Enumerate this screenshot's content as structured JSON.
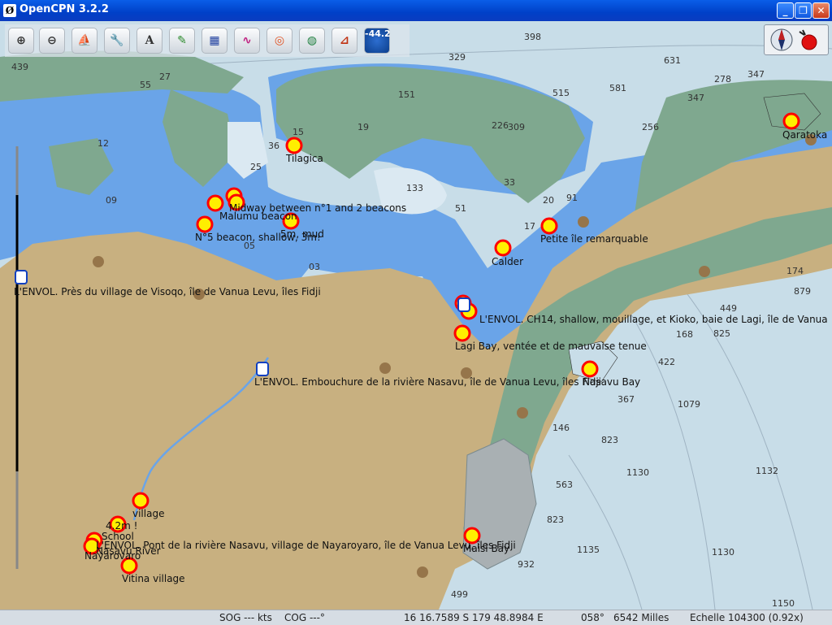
{
  "window": {
    "title": "OpenCPN 3.2.2",
    "buttons": {
      "minimize": "_",
      "restore": "❐",
      "close": "✕"
    }
  },
  "toolbar": {
    "tools": [
      {
        "name": "zoom-in-button",
        "glyph": "⊕"
      },
      {
        "name": "zoom-out-button",
        "glyph": "⊖"
      },
      {
        "name": "own-ship-button",
        "glyph": "⛵"
      },
      {
        "name": "settings-button",
        "glyph": "🔧"
      },
      {
        "name": "text-button",
        "glyph": "A"
      },
      {
        "name": "route-button",
        "glyph": "✎"
      },
      {
        "name": "chart-tool-button",
        "glyph": "▦"
      },
      {
        "name": "track-button",
        "glyph": "∿"
      },
      {
        "name": "lifebuoy-button",
        "glyph": "◎"
      },
      {
        "name": "ais-button",
        "glyph": "◍"
      },
      {
        "name": "tide-button",
        "glyph": "⊿"
      }
    ],
    "depth_value": "-44.2"
  },
  "compass": {
    "icon": "compass-icon",
    "status_icon": "gps-status-icon"
  },
  "status": {
    "sog": "SOG --- kts",
    "cog": "COG ---°",
    "position": "16 16.7589 S   179 48.8984 E",
    "bearing": "058°",
    "distance": "6542 Milles",
    "scale": "Echelle 104300 (0.92x)"
  },
  "colors": {
    "land": "#c8b080",
    "shallow": "#6aa4e8",
    "intertidal": "#7fa88f",
    "deep": "#c8dde8",
    "mark_fill": "#ffef00",
    "mark_ring": "#ff0000"
  },
  "map_labels": [
    "Tilagica",
    "Qaratoka",
    "Midway between n°1 and 2 beacons",
    "Malumu beacon",
    "N°5 beacon, shallow, 3m!",
    "5m, mud",
    "Calder",
    "Petite île remarquable",
    "L'ENVOL. Embouchure de la rivière Nasavu, île de Vanua Levu, îles Fidji",
    "L'ENVOL. Près du village de Visoqo, île de Vanua Levu, îles Fidji",
    "Lagi Bay, ventée et de mauvaise tenue",
    "L'ENVOL. CH14, shallow, mouillage, et Kioko, baie de Lagi, île de Vanua",
    "Nasavu Bay",
    "village",
    "4.2m !",
    "School",
    "Nayarovaro",
    "Nasavu River",
    "L'ENVOL. Pont de la rivière Nasavu, village de Nayaroyaro, île de Vanua Levu, îles Fidji",
    "Vitina village",
    "Maisi Bay"
  ],
  "depths": [
    "439",
    "398",
    "329",
    "631",
    "581",
    "515",
    "309",
    "256",
    "347",
    "278",
    "347",
    "174",
    "879",
    "825",
    "449",
    "422",
    "367",
    "1079",
    "823",
    "1130",
    "1132",
    "563",
    "823",
    "1135",
    "1130",
    "932",
    "499",
    "1150",
    "168",
    "226",
    "146",
    "151",
    "133",
    "25",
    "15",
    "19",
    "12",
    "09",
    "03",
    "05",
    "33",
    "20",
    "91",
    "51",
    "55",
    "27",
    "36",
    "17"
  ]
}
